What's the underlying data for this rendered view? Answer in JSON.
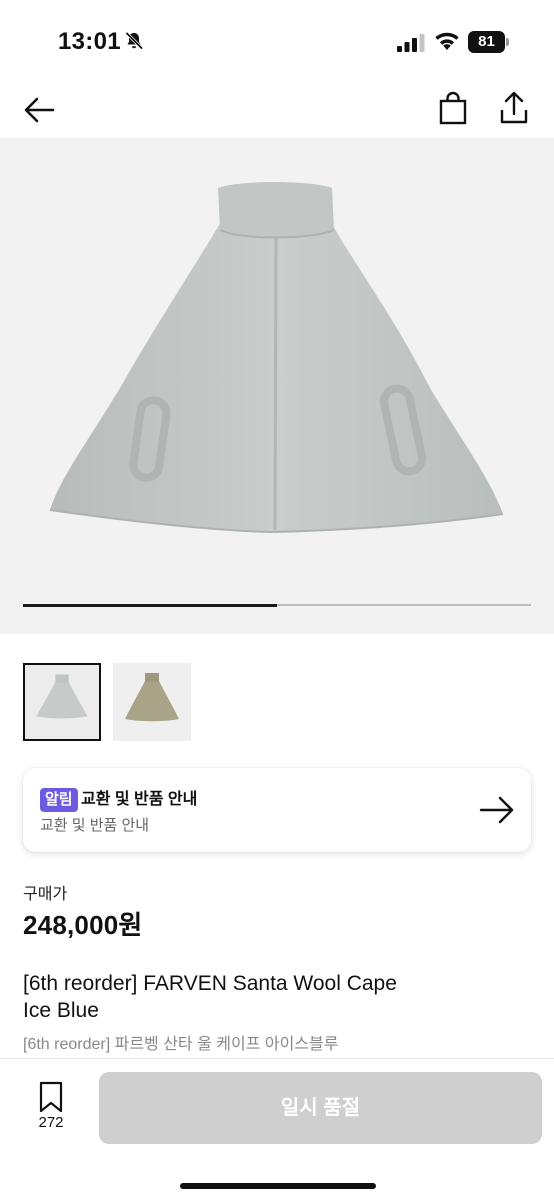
{
  "status_bar": {
    "time": "13:01",
    "battery": "81",
    "icons": [
      "bell-off-icon",
      "signal-icon",
      "wifi-icon",
      "battery-icon"
    ]
  },
  "nav": {
    "icons": [
      "back-arrow-icon",
      "shopping-bag-icon",
      "share-icon"
    ]
  },
  "gallery": {
    "image_count": 2,
    "current_index": 1,
    "progress_fraction": 0.5,
    "thumbnails": [
      {
        "color": "#c6cbc9",
        "selected": true
      },
      {
        "color": "#a9a387",
        "selected": false
      }
    ],
    "hero_color": "#c6cbc9"
  },
  "notice": {
    "badge": "알림",
    "title": "교환 및 반품 안내",
    "subtitle": "교환 및 반품 안내",
    "badge_color": "#6a5be0"
  },
  "price": {
    "label": "구매가",
    "value": "248,000원"
  },
  "product": {
    "name_line1": "[6th reorder] FARVEN Santa Wool Cape",
    "name_line2": "Ice Blue",
    "name_ko": "[6th reorder] 파르벵 산타 울 케이프 아이스블루"
  },
  "bottom_bar": {
    "wish_count": "272",
    "button_label": "일시 품절",
    "button_color": "#cfcfcf"
  }
}
